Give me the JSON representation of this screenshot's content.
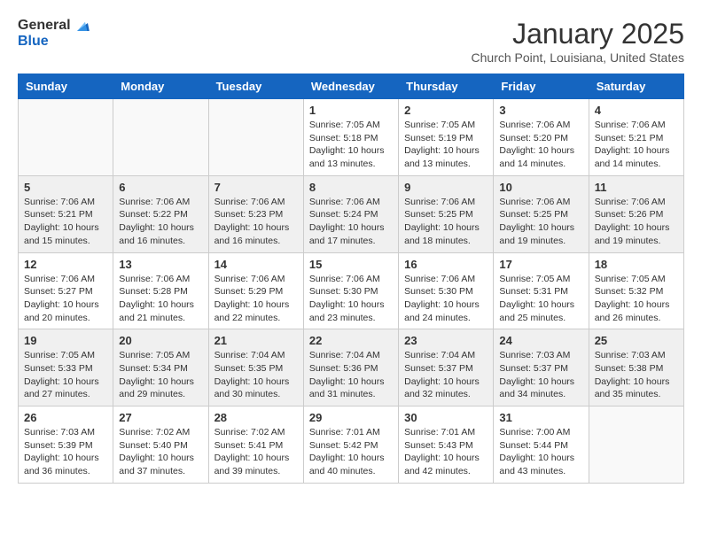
{
  "header": {
    "logo_line1": "General",
    "logo_line2": "Blue",
    "month": "January 2025",
    "location": "Church Point, Louisiana, United States"
  },
  "weekdays": [
    "Sunday",
    "Monday",
    "Tuesday",
    "Wednesday",
    "Thursday",
    "Friday",
    "Saturday"
  ],
  "weeks": [
    [
      {
        "day": "",
        "info": ""
      },
      {
        "day": "",
        "info": ""
      },
      {
        "day": "",
        "info": ""
      },
      {
        "day": "1",
        "info": "Sunrise: 7:05 AM\nSunset: 5:18 PM\nDaylight: 10 hours\nand 13 minutes."
      },
      {
        "day": "2",
        "info": "Sunrise: 7:05 AM\nSunset: 5:19 PM\nDaylight: 10 hours\nand 13 minutes."
      },
      {
        "day": "3",
        "info": "Sunrise: 7:06 AM\nSunset: 5:20 PM\nDaylight: 10 hours\nand 14 minutes."
      },
      {
        "day": "4",
        "info": "Sunrise: 7:06 AM\nSunset: 5:21 PM\nDaylight: 10 hours\nand 14 minutes."
      }
    ],
    [
      {
        "day": "5",
        "info": "Sunrise: 7:06 AM\nSunset: 5:21 PM\nDaylight: 10 hours\nand 15 minutes."
      },
      {
        "day": "6",
        "info": "Sunrise: 7:06 AM\nSunset: 5:22 PM\nDaylight: 10 hours\nand 16 minutes."
      },
      {
        "day": "7",
        "info": "Sunrise: 7:06 AM\nSunset: 5:23 PM\nDaylight: 10 hours\nand 16 minutes."
      },
      {
        "day": "8",
        "info": "Sunrise: 7:06 AM\nSunset: 5:24 PM\nDaylight: 10 hours\nand 17 minutes."
      },
      {
        "day": "9",
        "info": "Sunrise: 7:06 AM\nSunset: 5:25 PM\nDaylight: 10 hours\nand 18 minutes."
      },
      {
        "day": "10",
        "info": "Sunrise: 7:06 AM\nSunset: 5:25 PM\nDaylight: 10 hours\nand 19 minutes."
      },
      {
        "day": "11",
        "info": "Sunrise: 7:06 AM\nSunset: 5:26 PM\nDaylight: 10 hours\nand 19 minutes."
      }
    ],
    [
      {
        "day": "12",
        "info": "Sunrise: 7:06 AM\nSunset: 5:27 PM\nDaylight: 10 hours\nand 20 minutes."
      },
      {
        "day": "13",
        "info": "Sunrise: 7:06 AM\nSunset: 5:28 PM\nDaylight: 10 hours\nand 21 minutes."
      },
      {
        "day": "14",
        "info": "Sunrise: 7:06 AM\nSunset: 5:29 PM\nDaylight: 10 hours\nand 22 minutes."
      },
      {
        "day": "15",
        "info": "Sunrise: 7:06 AM\nSunset: 5:30 PM\nDaylight: 10 hours\nand 23 minutes."
      },
      {
        "day": "16",
        "info": "Sunrise: 7:06 AM\nSunset: 5:30 PM\nDaylight: 10 hours\nand 24 minutes."
      },
      {
        "day": "17",
        "info": "Sunrise: 7:05 AM\nSunset: 5:31 PM\nDaylight: 10 hours\nand 25 minutes."
      },
      {
        "day": "18",
        "info": "Sunrise: 7:05 AM\nSunset: 5:32 PM\nDaylight: 10 hours\nand 26 minutes."
      }
    ],
    [
      {
        "day": "19",
        "info": "Sunrise: 7:05 AM\nSunset: 5:33 PM\nDaylight: 10 hours\nand 27 minutes."
      },
      {
        "day": "20",
        "info": "Sunrise: 7:05 AM\nSunset: 5:34 PM\nDaylight: 10 hours\nand 29 minutes."
      },
      {
        "day": "21",
        "info": "Sunrise: 7:04 AM\nSunset: 5:35 PM\nDaylight: 10 hours\nand 30 minutes."
      },
      {
        "day": "22",
        "info": "Sunrise: 7:04 AM\nSunset: 5:36 PM\nDaylight: 10 hours\nand 31 minutes."
      },
      {
        "day": "23",
        "info": "Sunrise: 7:04 AM\nSunset: 5:37 PM\nDaylight: 10 hours\nand 32 minutes."
      },
      {
        "day": "24",
        "info": "Sunrise: 7:03 AM\nSunset: 5:37 PM\nDaylight: 10 hours\nand 34 minutes."
      },
      {
        "day": "25",
        "info": "Sunrise: 7:03 AM\nSunset: 5:38 PM\nDaylight: 10 hours\nand 35 minutes."
      }
    ],
    [
      {
        "day": "26",
        "info": "Sunrise: 7:03 AM\nSunset: 5:39 PM\nDaylight: 10 hours\nand 36 minutes."
      },
      {
        "day": "27",
        "info": "Sunrise: 7:02 AM\nSunset: 5:40 PM\nDaylight: 10 hours\nand 37 minutes."
      },
      {
        "day": "28",
        "info": "Sunrise: 7:02 AM\nSunset: 5:41 PM\nDaylight: 10 hours\nand 39 minutes."
      },
      {
        "day": "29",
        "info": "Sunrise: 7:01 AM\nSunset: 5:42 PM\nDaylight: 10 hours\nand 40 minutes."
      },
      {
        "day": "30",
        "info": "Sunrise: 7:01 AM\nSunset: 5:43 PM\nDaylight: 10 hours\nand 42 minutes."
      },
      {
        "day": "31",
        "info": "Sunrise: 7:00 AM\nSunset: 5:44 PM\nDaylight: 10 hours\nand 43 minutes."
      },
      {
        "day": "",
        "info": ""
      }
    ]
  ]
}
